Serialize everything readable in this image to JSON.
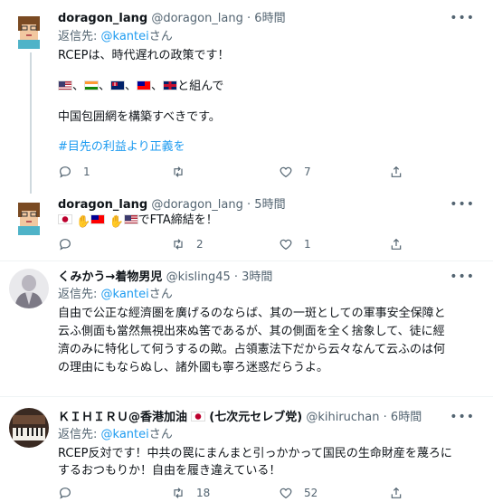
{
  "tweets": [
    {
      "display_name": "doragon_lang",
      "handle": "@doragon_lang",
      "separator": "·",
      "time": "6時間",
      "reply_prefix": "返信先: ",
      "reply_mention": "@kantei",
      "reply_suffix": "さん",
      "lines": [
        "RCEPは、時代遅れの政策です！",
        "と組んで",
        "中国包囲網を構築すべきです。"
      ],
      "flag_separator": "、",
      "hashtag": "#目先の利益より正義を",
      "reply_count": "1",
      "retweet_count": "",
      "like_count": "7"
    },
    {
      "display_name": "doragon_lang",
      "handle": "@doragon_lang",
      "separator": "·",
      "time": "5時間",
      "text_suffix": "でFTA締結を！",
      "reply_count": "",
      "retweet_count": "2",
      "like_count": "1"
    },
    {
      "display_name": "くみかう→着物男児",
      "handle": "@kisling45",
      "separator": "·",
      "time": "3時間",
      "reply_prefix": "返信先: ",
      "reply_mention": "@kantei",
      "reply_suffix": "さん",
      "lines": [
        "自由で公正な經濟圏を廣げるのならば、其の一斑としての軍事安全保障と",
        "云ふ側面も當然無視出來ぬ筈であるが、其の側面を全く捨象して、徒に經",
        "濟のみに特化して何うするの歟。占領憲法下だから云々なんて云ふのは何",
        "の理由にもならぬし、諸外國も寧ろ迷惑だらうよ。"
      ]
    },
    {
      "display_name": "ＫＩＨＩＲＵ@香港加油",
      "display_name_suffix": "(七次元セレブ党)",
      "handle": "@kihiruchan",
      "separator": "·",
      "time": "6時間",
      "reply_prefix": "返信先: ",
      "reply_mention": "@kantei",
      "reply_suffix": "さん",
      "lines": [
        "RCEP反対です！中共の罠にまんまと引っかかって国民の生命財産を蔑ろに",
        "するおつもりか！自由を履き違えている！"
      ],
      "retweet_count": "18",
      "like_count": "52"
    }
  ],
  "icons": {
    "more": "more-horizontal-icon",
    "reply": "reply-icon",
    "retweet": "retweet-icon",
    "like": "heart-icon",
    "share": "share-icon"
  },
  "colors": {
    "link": "#1d9bf0",
    "secondary_text": "#536471",
    "divider": "#eff3f4",
    "thread_line": "#cfd9de"
  }
}
